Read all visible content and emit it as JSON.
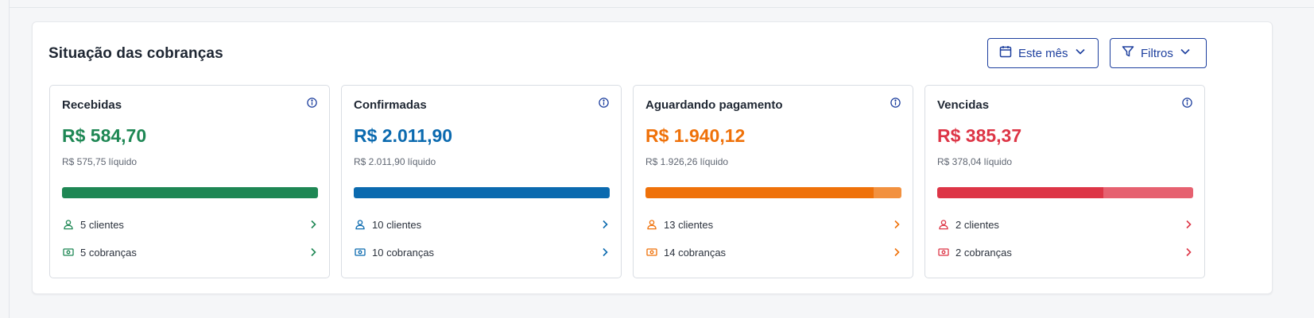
{
  "panel": {
    "title": "Situação das cobranças",
    "period_button": "Este mês",
    "filters_button": "Filtros"
  },
  "cards": [
    {
      "title": "Recebidas",
      "amount": "R$ 584,70",
      "net": "R$ 575,75 líquido",
      "clients": "5 clientes",
      "charges": "5 cobranças",
      "color": "#1e8754",
      "light_color": "#1e8754",
      "bar_fill_fraction": 1.0
    },
    {
      "title": "Confirmadas",
      "amount": "R$ 2.011,90",
      "net": "R$ 2.011,90 líquido",
      "clients": "10 clientes",
      "charges": "10 cobranças",
      "color": "#0b6aaf",
      "light_color": "#0b6aaf",
      "bar_fill_fraction": 1.0
    },
    {
      "title": "Aguardando pagamento",
      "amount": "R$ 1.940,12",
      "net": "R$ 1.926,26 líquido",
      "clients": "13 clientes",
      "charges": "14 cobranças",
      "color": "#ef7109",
      "light_color": "#f2913f",
      "bar_fill_fraction": 0.89
    },
    {
      "title": "Vencidas",
      "amount": "R$ 385,37",
      "net": "R$ 378,04 líquido",
      "clients": "2 clientes",
      "charges": "2 cobranças",
      "color": "#dd3546",
      "light_color": "#e66170",
      "bar_fill_fraction": 0.65
    }
  ]
}
